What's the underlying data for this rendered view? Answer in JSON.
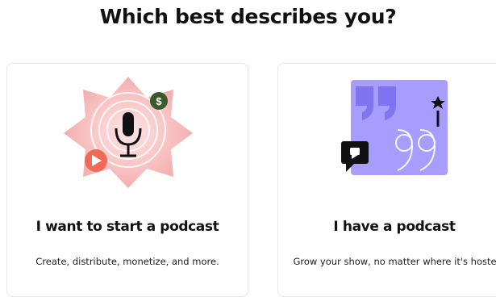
{
  "page": {
    "title": "Which best describes you?"
  },
  "options": [
    {
      "heading": "I want to start a podcast",
      "description": "Create, distribute, monetize, and more.",
      "icons": [
        "microphone-icon",
        "dollar-icon",
        "play-icon"
      ],
      "colors": {
        "burst": "#f7b8b8",
        "play": "#f06a5a",
        "dollar": "#3a5a2c"
      }
    },
    {
      "heading": "I have a podcast",
      "description": "Grow your show, no matter where it's hosted.",
      "icons": [
        "quote-icon",
        "chat-bubble-icon",
        "star-icon"
      ],
      "colors": {
        "panel": "#a89dff",
        "quote": "#8274f0",
        "bubble": "#111111"
      }
    }
  ]
}
